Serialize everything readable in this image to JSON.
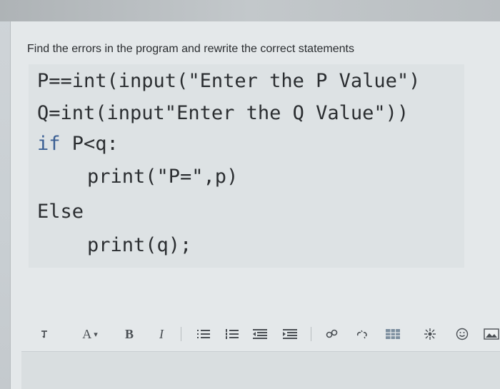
{
  "question": "Find the errors in the program and rewrite the correct statements",
  "code": {
    "line1": "P==int(input(\"Enter the P Value\")",
    "line2": "Q=int(input\"Enter the Q Value\"))",
    "line3_kw": "if",
    "line3_rest": " P<q:",
    "line4": "print(\"P=\",p)",
    "line5": "Else",
    "line6": "print(q);"
  },
  "toolbar": {
    "paragraph_icon": "paragraph-icon",
    "font_color_label": "A",
    "font_color_caret": "▾",
    "bold_label": "B",
    "italic_label": "I",
    "icons": [
      "unordered-list-icon",
      "ordered-list-icon",
      "outdent-icon",
      "indent-icon",
      "link-icon",
      "unlink-icon",
      "table-icon",
      "special-character-icon",
      "emoji-icon",
      "image-icon"
    ]
  },
  "colors": {
    "page_bg": "#e4e8ea",
    "code_bg": "#dde2e4",
    "keyword": "#3b5f93"
  }
}
